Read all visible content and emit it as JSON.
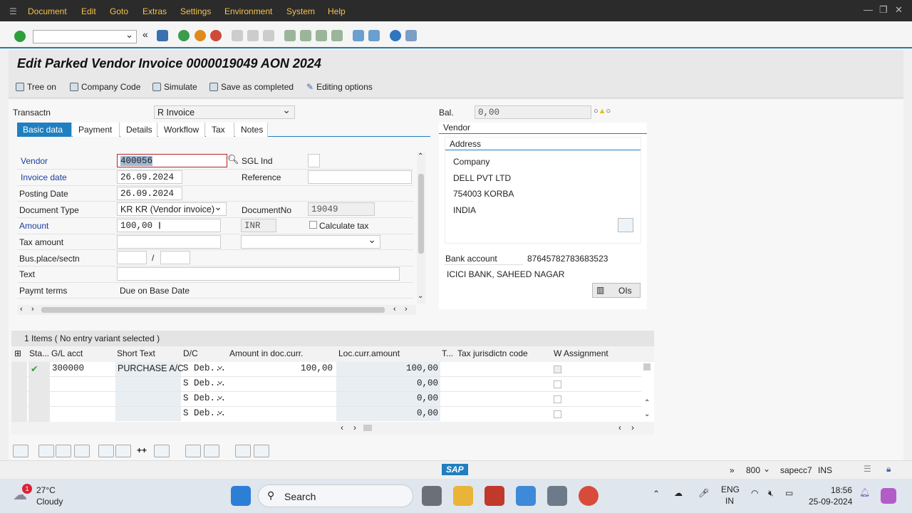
{
  "menu": [
    "Document",
    "Edit",
    "Goto",
    "Extras",
    "Settings",
    "Environment",
    "System",
    "Help"
  ],
  "title": "Edit Parked Vendor Invoice 0000019049 AON  2024",
  "app_toolbar": {
    "tree_on": "Tree on",
    "company_code": "Company Code",
    "simulate": "Simulate",
    "save_as_completed": "Save as completed",
    "editing_options": "Editing options"
  },
  "transaction": {
    "label": "Transactn",
    "value": "R Invoice"
  },
  "balance": {
    "label": "Bal.",
    "value": "0,00"
  },
  "tabs": [
    "Basic data",
    "Payment",
    "Details",
    "Workflow",
    "Tax",
    "Notes"
  ],
  "form": {
    "vendor_label": "Vendor",
    "vendor_value": "400056",
    "sgl_label": "SGL Ind",
    "invoice_date_label": "Invoice date",
    "invoice_date_value": "26.09.2024",
    "reference_label": "Reference",
    "posting_date_label": "Posting Date",
    "posting_date_value": "26.09.2024",
    "doctype_label": "Document Type",
    "doctype_value": "KR KR (Vendor invoice)",
    "docno_label": "DocumentNo",
    "docno_value": "19049",
    "amount_label": "Amount",
    "amount_value": "100,00",
    "currency_value": "INR",
    "calc_tax_label": "Calculate tax",
    "tax_amount_label": "Tax amount",
    "busplace_label": "Bus.place/sectn",
    "slash": "/",
    "text_label": "Text",
    "paymt_terms_label": "Paymt terms",
    "paymt_terms_value": "Due on Base Date"
  },
  "vendor_panel": {
    "title": "Vendor",
    "address_title": "Address",
    "address_lines": [
      "Company",
      "DELL PVT LTD",
      "754003 KORBA",
      "INDIA"
    ],
    "bank_account_label": "Bank account",
    "bank_account_value": "87645782783683523",
    "bank_name": "ICICI BANK, SAHEED NAGAR",
    "ois_label": "OIs"
  },
  "items": {
    "header": "1 Items ( No entry variant selected )",
    "columns": [
      "Sta...",
      "G/L acct",
      "Short Text",
      "D/C",
      "Amount in doc.curr.",
      "Loc.curr.amount",
      "T...",
      "Tax jurisdictn code",
      "W",
      "Assignment"
    ],
    "rows": [
      {
        "gl": "300000",
        "short": "PURCHASE A/C",
        "dc": "S  Deb...",
        "amount": "100,00",
        "loc": "100,00"
      },
      {
        "gl": "",
        "short": "",
        "dc": "S  Deb...",
        "amount": "",
        "loc": "0,00"
      },
      {
        "gl": "",
        "short": "",
        "dc": "S  Deb...",
        "amount": "",
        "loc": "0,00"
      },
      {
        "gl": "",
        "short": "",
        "dc": "S  Deb...",
        "amount": "",
        "loc": "0,00"
      }
    ]
  },
  "status": {
    "client": "800",
    "server": "sapecc7",
    "mode": "INS",
    "logo": "SAP"
  },
  "taskbar": {
    "weather_temp": "27°C",
    "weather_desc": "Cloudy",
    "badge": "1",
    "search": "Search",
    "lang1": "ENG",
    "lang2": "IN",
    "time": "18:56",
    "date": "25-09-2024"
  }
}
